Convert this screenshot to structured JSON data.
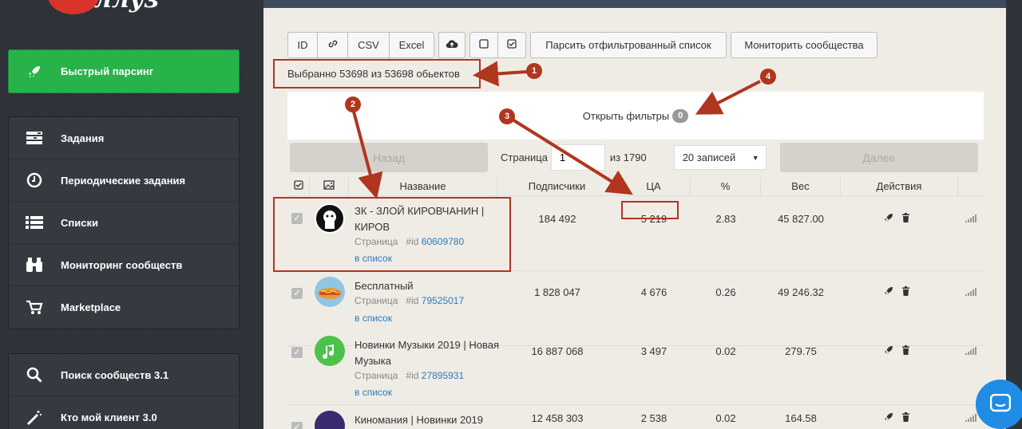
{
  "sidebar": {
    "logo_text": "ллуз",
    "primary": {
      "label": "Быстрый парсинг",
      "icon": "rocket-icon"
    },
    "group1": [
      {
        "label": "Задания",
        "icon": "tasks-icon"
      },
      {
        "label": "Периодические задания",
        "icon": "clock-icon"
      },
      {
        "label": "Списки",
        "icon": "list-icon"
      },
      {
        "label": "Мониторинг сообществ",
        "icon": "binoculars-icon"
      },
      {
        "label": "Marketplace",
        "icon": "cart-icon"
      }
    ],
    "group2": [
      {
        "label": "Поиск сообществ 3.1",
        "icon": "search-icon"
      },
      {
        "label": "Кто мой клиент 3.0",
        "icon": "magic-wand-icon"
      }
    ]
  },
  "toolbar": {
    "id_label": "ID",
    "csv_label": "CSV",
    "excel_label": "Excel",
    "parse_filtered_label": "Парсить отфильтрованный список",
    "monitor_label": "Мониторить сообщества"
  },
  "selection": {
    "text": "Выбранно 53698 из 53698 обьектов"
  },
  "filters": {
    "label": "Открыть фильтры",
    "count": "0"
  },
  "pager": {
    "back_label": "Назад",
    "page_label": "Страница",
    "page_value": "1",
    "of_label": "из 1790",
    "per_page": "20 записей",
    "next_label": "Далее"
  },
  "table": {
    "headers": [
      "Название",
      "Подписчики",
      "ЦА",
      "%",
      "Вес",
      "Действия"
    ],
    "rows": [
      {
        "name": "ЗК - ЗЛОЙ КИРОВЧАНИН | КИРОВ",
        "type": "Страница",
        "id_prefix": "#id",
        "id": "60609780",
        "to_list": "в список",
        "subscribers": "184 492",
        "ca": "5 219",
        "percent": "2.83",
        "weight": "45 827.00"
      },
      {
        "name": "Бесплатный",
        "type": "Страница",
        "id_prefix": "#id",
        "id": "79525017",
        "to_list": "в список",
        "subscribers": "1 828 047",
        "ca": "4 676",
        "percent": "0.26",
        "weight": "49 246.32"
      },
      {
        "name": "Новинки Музыки 2019 | Новая Музыка",
        "type": "Страница",
        "id_prefix": "#id",
        "id": "27895931",
        "to_list": "в список",
        "subscribers": "16 887 068",
        "ca": "3 497",
        "percent": "0.02",
        "weight": "279.75"
      },
      {
        "name": "Киномания | Новинки 2019",
        "subscribers": "12 458 303",
        "ca": "2 538",
        "percent": "0.02",
        "weight": "164.58"
      }
    ]
  },
  "markers": [
    "1",
    "2",
    "3",
    "4"
  ],
  "colors": {
    "accent_green": "#28b34a",
    "annotation_red": "#b0361f",
    "link_blue": "#2a7abf"
  }
}
